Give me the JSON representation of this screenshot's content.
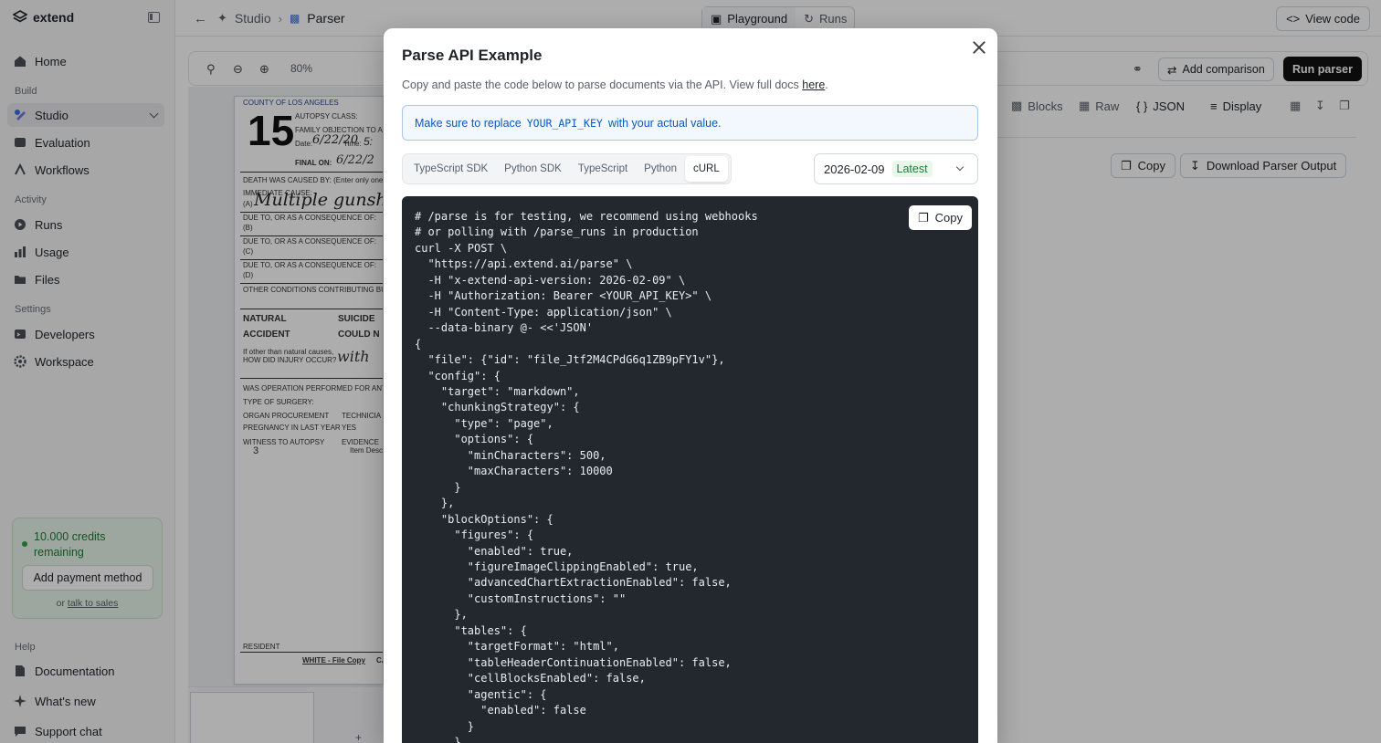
{
  "sidebar": {
    "brand": "extend",
    "items": [
      {
        "label": "Home"
      },
      {
        "label": "Studio"
      },
      {
        "label": "Evaluation"
      },
      {
        "label": "Workflows"
      },
      {
        "label": "Runs"
      },
      {
        "label": "Usage"
      },
      {
        "label": "Files"
      },
      {
        "label": "Developers"
      },
      {
        "label": "Workspace"
      },
      {
        "label": "Documentation"
      },
      {
        "label": "What's new"
      },
      {
        "label": "Support chat"
      }
    ],
    "sections": {
      "build": "Build",
      "activity": "Activity",
      "settings": "Settings",
      "help": "Help"
    },
    "credits": {
      "text": "10.000 credits remaining",
      "button": "Add payment method",
      "prefix": "or",
      "link": "talk to sales"
    }
  },
  "header": {
    "breadcrumb": [
      "Studio",
      "Parser"
    ],
    "tabs": [
      "Playground",
      "Runs"
    ],
    "view_code": "View code"
  },
  "toolbar": {
    "zoom": "80%",
    "add_comparison": "Add comparison",
    "run_parser": "Run parser"
  },
  "output_toolbar": {
    "blocks": "Blocks",
    "raw": "Raw",
    "json": "JSON",
    "display": "Display",
    "copy": "Copy",
    "download": "Download Parser Output"
  },
  "document": {
    "lines": [
      "COUNTY OF LOS ANGELES",
      "AUTOPSY CLASS:",
      "FAMILY OBJECTION TO AL",
      "Date:",
      "Time:",
      "FINAL ON:",
      "DEATH WAS CAUSED BY: (Enter only one cause",
      "IMMEDIATE CAUSE:",
      "(A)",
      "DUE TO, OR AS A CONSEQUENCE OF:",
      "(B)",
      "DUE TO, OR AS A CONSEQUENCE OF:",
      "(C)",
      "DUE TO, OR AS A CONSEQUENCE OF:",
      "(D)",
      "OTHER CONDITIONS CONTRIBUTING BUT NOT REL",
      "NATURAL",
      "SUICIDE",
      "ACCIDENT",
      "COULD N",
      "If other than natural causes,",
      "HOW DID INJURY OCCUR?",
      "WAS OPERATION PERFORMED FOR ANY CON",
      "TYPE OF SURGERY:",
      "ORGAN PROCUREMENT",
      "TECHNICIA",
      "PREGNANCY IN LAST YEAR",
      "YES",
      "WITNESS TO AUTOPSY",
      "EVIDENCE",
      "Item Descri",
      "RESIDENT",
      "WHITE - File Copy",
      "CA"
    ],
    "number": "15",
    "handwriting": [
      "6/22/20",
      "5:",
      "6/22/2",
      "Multiple gunshot",
      "with",
      "3"
    ]
  },
  "thumbnails": {
    "add_label": "+ Add"
  },
  "modal": {
    "title": "Parse API Example",
    "description": "Copy and paste the code below to parse documents via the API. View full docs",
    "description_link": "here",
    "note_prefix": "Make sure to replace",
    "note_code": "YOUR_API_KEY",
    "note_suffix": "with your actual value.",
    "languages": [
      "TypeScript SDK",
      "Python SDK",
      "TypeScript",
      "Python",
      "cURL"
    ],
    "selected_language": "cURL",
    "version": "2026-02-09",
    "version_tag": "Latest",
    "copy": "Copy",
    "code": "# /parse is for testing, we recommend using webhooks\n# or polling with /parse_runs in production\ncurl -X POST \\\n  \"https://api.extend.ai/parse\" \\\n  -H \"x-extend-api-version: 2026-02-09\" \\\n  -H \"Authorization: Bearer <YOUR_API_KEY>\" \\\n  -H \"Content-Type: application/json\" \\\n  --data-binary @- <<'JSON'\n{\n  \"file\": {\"id\": \"file_Jtf2M4CPdG6q1ZB9pFY1v\"},\n  \"config\": {\n    \"target\": \"markdown\",\n    \"chunkingStrategy\": {\n      \"type\": \"page\",\n      \"options\": {\n        \"minCharacters\": 500,\n        \"maxCharacters\": 10000\n      }\n    },\n    \"blockOptions\": {\n      \"figures\": {\n        \"enabled\": true,\n        \"figureImageClippingEnabled\": true,\n        \"advancedChartExtractionEnabled\": false,\n        \"customInstructions\": \"\"\n      },\n      \"tables\": {\n        \"targetFormat\": \"html\",\n        \"tableHeaderContinuationEnabled\": false,\n        \"cellBlocksEnabled\": false,\n        \"agentic\": {\n          \"enabled\": false\n        }\n      },"
  }
}
